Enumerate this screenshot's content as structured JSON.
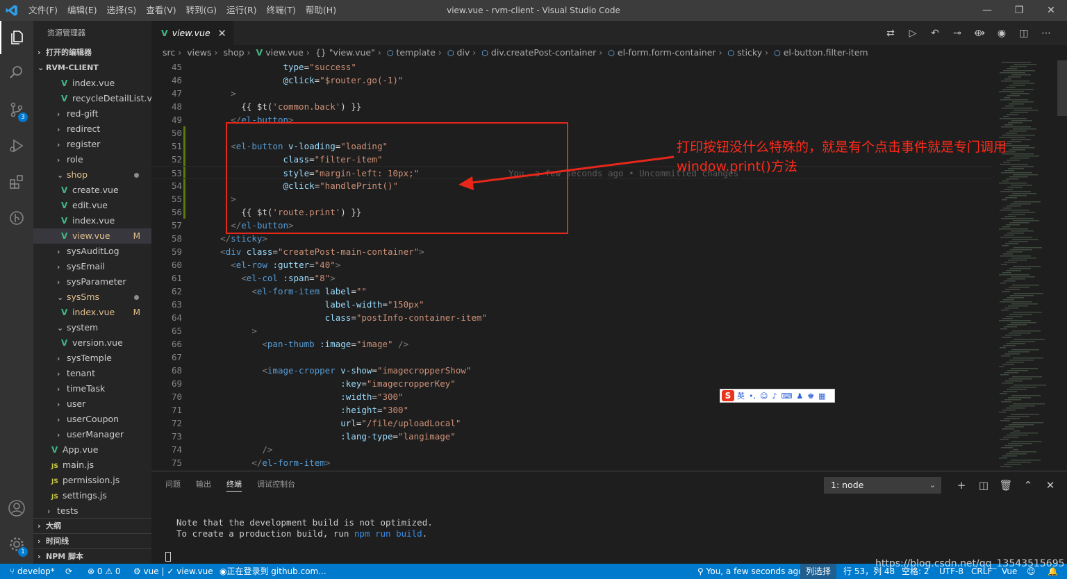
{
  "titlebar": {
    "menu": [
      "文件(F)",
      "编辑(E)",
      "选择(S)",
      "查看(V)",
      "转到(G)",
      "运行(R)",
      "终端(T)",
      "帮助(H)"
    ],
    "title": "view.vue - rvm-client - Visual Studio Code",
    "minimize": "—",
    "restore": "❐",
    "close": "✕"
  },
  "activity": {
    "scm_badge": "3",
    "settings_badge": "1"
  },
  "sidebar": {
    "title": "资源管理器",
    "open_editors": "打开的编辑器",
    "project": "RVM-CLIENT",
    "outline": "大纲",
    "timeline": "时间线",
    "npm": "NPM 脚本"
  },
  "tree": [
    {
      "label": "index.vue",
      "icon": "vue"
    },
    {
      "label": "recycleDetailList.v...",
      "icon": "vue"
    },
    {
      "label": "red-gift",
      "icon": "folder"
    },
    {
      "label": "redirect",
      "icon": "folder"
    },
    {
      "label": "register",
      "icon": "folder"
    },
    {
      "label": "role",
      "icon": "folder"
    },
    {
      "label": "shop",
      "icon": "folder-open"
    },
    {
      "label": "create.vue",
      "icon": "vue"
    },
    {
      "label": "edit.vue",
      "icon": "vue"
    },
    {
      "label": "index.vue",
      "icon": "vue"
    },
    {
      "label": "view.vue",
      "icon": "vue",
      "git": "M"
    },
    {
      "label": "sysAuditLog",
      "icon": "folder"
    },
    {
      "label": "sysEmail",
      "icon": "folder"
    },
    {
      "label": "sysParameter",
      "icon": "folder"
    },
    {
      "label": "sysSms",
      "icon": "folder-open"
    },
    {
      "label": "index.vue",
      "icon": "vue",
      "git": "M"
    },
    {
      "label": "system",
      "icon": "folder-open"
    },
    {
      "label": "version.vue",
      "icon": "vue"
    },
    {
      "label": "sysTemple",
      "icon": "folder"
    },
    {
      "label": "tenant",
      "icon": "folder"
    },
    {
      "label": "timeTask",
      "icon": "folder"
    },
    {
      "label": "user",
      "icon": "folder"
    },
    {
      "label": "userCoupon",
      "icon": "folder"
    },
    {
      "label": "userManager",
      "icon": "folder"
    },
    {
      "label": "App.vue",
      "icon": "vue"
    },
    {
      "label": "main.js",
      "icon": "js"
    },
    {
      "label": "permission.js",
      "icon": "js"
    },
    {
      "label": "settings.js",
      "icon": "js"
    },
    {
      "label": "tests",
      "icon": "folder"
    }
  ],
  "editor": {
    "tab_label": "view.vue",
    "tab_close": "✕",
    "breadcrumbs": [
      "src",
      "views",
      "shop",
      "view.vue",
      "\"view.vue\"",
      "template",
      "div",
      "div.createPost-container",
      "el-form.form-container",
      "sticky",
      "el-button.filter-item"
    ],
    "blame": "You, a few seconds ago • Uncommitted changes"
  },
  "code_lines": [
    {
      "n": "45",
      "t": "                  type=\"success\""
    },
    {
      "n": "46",
      "t": "                  @click=\"$router.go(-1)\""
    },
    {
      "n": "47",
      "t": "        >"
    },
    {
      "n": "48",
      "t": "          {{ $t('common.back') }}"
    },
    {
      "n": "49",
      "t": "        </el-button>"
    },
    {
      "n": "50",
      "t": ""
    },
    {
      "n": "51",
      "t": "        <el-button v-loading=\"loading\""
    },
    {
      "n": "52",
      "t": "                  class=\"filter-item\""
    },
    {
      "n": "53",
      "t": "                  style=\"margin-left: 10px;\""
    },
    {
      "n": "54",
      "t": "                  @click=\"handlePrint()\""
    },
    {
      "n": "55",
      "t": "        >"
    },
    {
      "n": "56",
      "t": "          {{ $t('route.print') }}"
    },
    {
      "n": "57",
      "t": "        </el-button>"
    },
    {
      "n": "58",
      "t": "      </sticky>"
    },
    {
      "n": "59",
      "t": "      <div class=\"createPost-main-container\">"
    },
    {
      "n": "60",
      "t": "        <el-row :gutter=\"40\">"
    },
    {
      "n": "61",
      "t": "          <el-col :span=\"8\">"
    },
    {
      "n": "62",
      "t": "            <el-form-item label=\"\""
    },
    {
      "n": "63",
      "t": "                          label-width=\"150px\""
    },
    {
      "n": "64",
      "t": "                          class=\"postInfo-container-item\""
    },
    {
      "n": "65",
      "t": "            >"
    },
    {
      "n": "66",
      "t": "              <pan-thumb :image=\"image\" />"
    },
    {
      "n": "67",
      "t": ""
    },
    {
      "n": "68",
      "t": "              <image-cropper v-show=\"imagecropperShow\""
    },
    {
      "n": "69",
      "t": "                             :key=\"imagecropperKey\""
    },
    {
      "n": "70",
      "t": "                             :width=\"300\""
    },
    {
      "n": "71",
      "t": "                             :height=\"300\""
    },
    {
      "n": "72",
      "t": "                             url=\"/file/uploadLocal\""
    },
    {
      "n": "73",
      "t": "                             :lang-type=\"langimage\""
    },
    {
      "n": "74",
      "t": "              />"
    },
    {
      "n": "75",
      "t": "            </el-form-item>"
    }
  ],
  "annotation": {
    "line1": "打印按钮没什么特殊的，就是有个点击事件就是专门调用",
    "line2": "window.print()方法",
    "color": "#ff2a1a"
  },
  "ime": {
    "logo": "S",
    "label": "英"
  },
  "panel": {
    "tabs": [
      "问题",
      "输出",
      "终端",
      "调试控制台"
    ],
    "active_tab": "终端",
    "terminal_select": "1: node",
    "terminal_lines": [
      "Note that the development build is not optimized.",
      "To create a production build, run "
    ],
    "terminal_cmd": "npm run build",
    "terminal_end": "."
  },
  "statusbar": {
    "branch": "develop*",
    "problems": "⊗ 0 ⚠ 0",
    "vue": "vue | ✓ view.vue",
    "github": "正在登录到 github.com...",
    "blame": "You, a few seconds ago",
    "column_select": "列选择",
    "position": "行 53，列 48",
    "spaces": "空格: 2",
    "encoding": "UTF-8",
    "eol": "CRLF",
    "language": "Vue",
    "bg_color": "#007acc"
  },
  "watermark": "https://blog.csdn.net/qq_13543515695"
}
